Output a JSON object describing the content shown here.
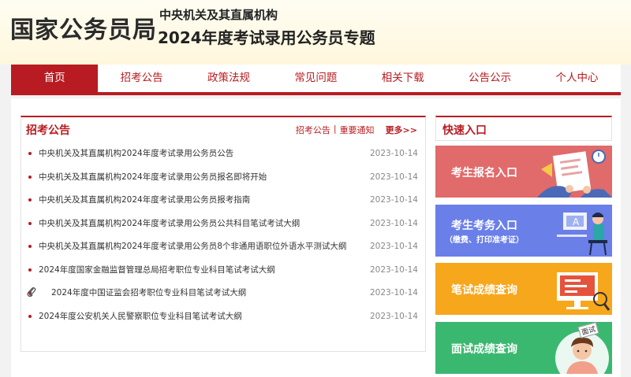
{
  "header": {
    "logo": "国家公务员局",
    "subtitle": "中央机关及其直属机构",
    "title": "2024年度考试录用公务员专题"
  },
  "nav": {
    "items": [
      "首页",
      "招考公告",
      "政策法规",
      "常见问题",
      "相关下载",
      "公告公示",
      "个人中心"
    ],
    "active": "首页"
  },
  "news": {
    "title": "招考公告",
    "links": {
      "announcement": "招考公告",
      "separator": "|",
      "notice": "重要通知",
      "more": "更多>>"
    },
    "items": [
      {
        "title": "中央机关及其直属机构2024年度考试录用公务员公告",
        "date": "2023-10-14"
      },
      {
        "title": "中央机关及其直属机构2024年度考试录用公务员报名即将开始",
        "date": "2023-10-14"
      },
      {
        "title": "中央机关及其直属机构2024年度考试录用公务员报考指南",
        "date": "2023-10-14"
      },
      {
        "title": "中央机关及其直属机构2024年度考试录用公务员公共科目笔试考试大纲",
        "date": "2023-10-14"
      },
      {
        "title": "中央机关及其直属机构2024年度考试录用公务员8个非通用语职位外语水平测试大纲",
        "date": "2023-10-14"
      },
      {
        "title": "2024年度国家金融监督管理总局招考职位专业科目笔试考试大纲",
        "date": "2023-10-14"
      },
      {
        "title": "2024年度中国证监会招考职位专业科目笔试考试大纲",
        "date": "2023-10-14"
      },
      {
        "title": "2024年度公安机关人民警察职位专业科目笔试考试大纲",
        "date": "2023-10-14"
      }
    ]
  },
  "quick": {
    "title": "快速入口",
    "registration": "考生报名入口",
    "exam_affairs": "考生考务入口",
    "exam_affairs_sub": "（缴费、打印准考证）",
    "written_score": "笔试成绩查询",
    "interview_score": "面试成绩查询",
    "interview_badge": "面试"
  },
  "colors": {
    "brand": "#b81c22",
    "card_registration": "#e16a6a",
    "card_exam_affairs": "#6a7fe8",
    "card_written": "#f7a71c",
    "card_interview": "#3bb870"
  },
  "icons": {
    "attachment": "paperclip-icon"
  }
}
